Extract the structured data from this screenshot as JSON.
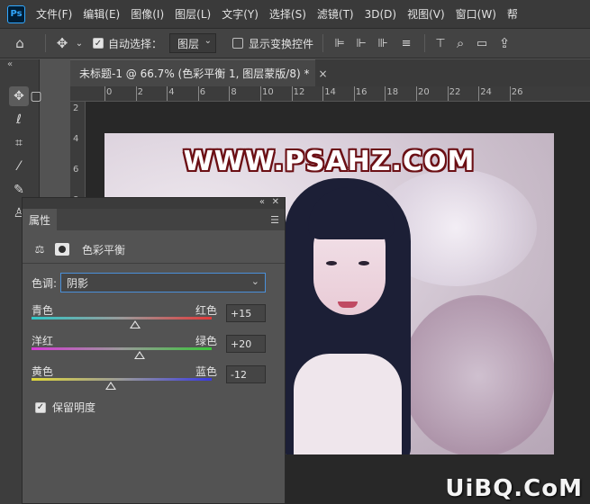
{
  "app": {
    "logo": "Ps"
  },
  "menu": [
    "文件(F)",
    "编辑(E)",
    "图像(I)",
    "图层(L)",
    "文字(Y)",
    "选择(S)",
    "滤镜(T)",
    "3D(D)",
    "视图(V)",
    "窗口(W)",
    "帮"
  ],
  "options": {
    "auto_select_label": "自动选择：",
    "auto_select_checked": true,
    "layer_dropdown": "图层",
    "transform_controls_label": "显示变换控件",
    "transform_controls_checked": false
  },
  "document": {
    "tab_title": "未标题-1 @ 66.7% (色彩平衡 1, 图层蒙版/8) *",
    "close_glyph": "×"
  },
  "ruler": {
    "h_ticks": [
      "0",
      "2",
      "4",
      "6",
      "8",
      "10",
      "12",
      "14",
      "16",
      "18",
      "20",
      "22",
      "24",
      "26"
    ],
    "v_ticks": [
      "2",
      "4",
      "6",
      "8"
    ]
  },
  "canvas": {
    "watermark_text": "WWW.PSAHZ.COM"
  },
  "properties": {
    "tab_label": "属性",
    "adjustment_title": "色彩平衡",
    "tone_label": "色调:",
    "tone_value": "阴影",
    "sliders": [
      {
        "left": "青色",
        "right": "红色",
        "value": "+15",
        "level": 15,
        "from": "#2fc6c6",
        "to": "#e23a3a"
      },
      {
        "left": "洋红",
        "right": "绿色",
        "value": "+20",
        "level": 20,
        "from": "#d43ad4",
        "to": "#3ac43a"
      },
      {
        "left": "黄色",
        "right": "蓝色",
        "value": "-12",
        "level": -12,
        "from": "#e0d83a",
        "to": "#3a3ae0"
      }
    ],
    "preserve_label": "保留明度",
    "preserve_checked": true
  },
  "brand": "UiBQ.CoM"
}
